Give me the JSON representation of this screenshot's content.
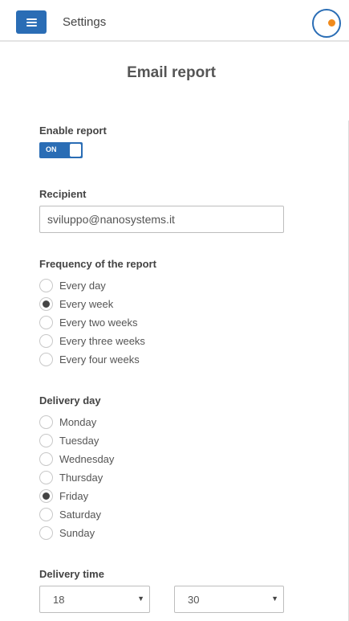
{
  "header": {
    "title": "Settings",
    "menu_icon": "hamburger-menu-icon",
    "logo_icon": "brand-circle-logo",
    "colors": {
      "accent": "#2a6db5",
      "logo_dot": "#f08a1c"
    }
  },
  "page": {
    "title": "Email report"
  },
  "enable_report": {
    "label": "Enable report",
    "toggle_text": "ON",
    "enabled": true
  },
  "recipient": {
    "label": "Recipient",
    "value": "sviluppo@nanosystems.it"
  },
  "frequency": {
    "label": "Frequency of the report",
    "selected": "Every week",
    "options": [
      {
        "label": "Every day",
        "checked": false
      },
      {
        "label": "Every week",
        "checked": true
      },
      {
        "label": "Every two weeks",
        "checked": false
      },
      {
        "label": "Every three weeks",
        "checked": false
      },
      {
        "label": "Every four weeks",
        "checked": false
      }
    ]
  },
  "delivery_day": {
    "label": "Delivery day",
    "selected": "Friday",
    "options": [
      {
        "label": "Monday",
        "checked": false
      },
      {
        "label": "Tuesday",
        "checked": false
      },
      {
        "label": "Wednesday",
        "checked": false
      },
      {
        "label": "Thursday",
        "checked": false
      },
      {
        "label": "Friday",
        "checked": true
      },
      {
        "label": "Saturday",
        "checked": false
      },
      {
        "label": "Sunday",
        "checked": false
      }
    ]
  },
  "delivery_time": {
    "label": "Delivery time",
    "hour": "18",
    "minute": "30",
    "caret_icon": "dropdown-caret-icon"
  }
}
